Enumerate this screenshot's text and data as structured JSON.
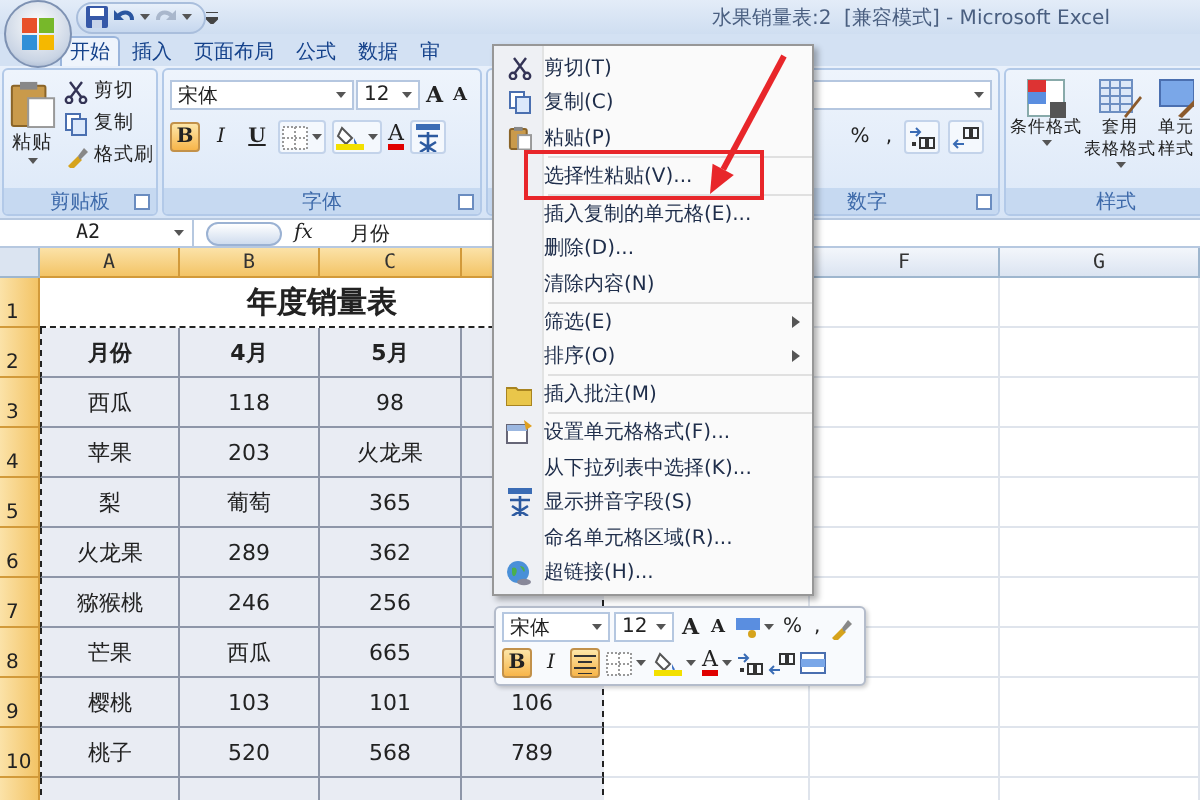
{
  "window": {
    "title": "水果销量表:2  [兼容模式] - Microsoft Excel"
  },
  "tabs": [
    {
      "label": "开始",
      "selected": true
    },
    {
      "label": "插入",
      "selected": false
    },
    {
      "label": "页面布局",
      "selected": false
    },
    {
      "label": "公式",
      "selected": false
    },
    {
      "label": "数据",
      "selected": false
    },
    {
      "label": "审",
      "selected": false
    }
  ],
  "ribbon": {
    "clipboard": {
      "paste": "粘贴",
      "items": [
        "剪切",
        "复制",
        "格式刷"
      ],
      "label": "剪贴板"
    },
    "font": {
      "family": "宋体",
      "size": "12",
      "grow": "A",
      "shrink": "A",
      "color_letter": "A",
      "toggles": [
        {
          "kind": "bold",
          "label": "B",
          "on": true
        },
        {
          "kind": "italic",
          "label": "I",
          "on": false
        },
        {
          "kind": "underline",
          "label": "U",
          "on": false
        }
      ],
      "label": "字体"
    },
    "number": {
      "symbols": [
        "%",
        ","
      ],
      "label": "数字"
    },
    "styles": {
      "buttons": [
        {
          "lines": [
            "条件格式"
          ]
        },
        {
          "lines": [
            "套用",
            "表格格式"
          ]
        },
        {
          "lines": [
            "单元",
            "样式"
          ]
        }
      ],
      "label": "样式"
    }
  },
  "formula_bar": {
    "name_box": "A2",
    "fx": "fx",
    "value": "月份"
  },
  "sheet": {
    "columns": [
      {
        "label": "A",
        "selected": true
      },
      {
        "label": "B",
        "selected": true
      },
      {
        "label": "C",
        "selected": true
      },
      {
        "label": "F",
        "selected": false
      },
      {
        "label": "G",
        "selected": false
      }
    ],
    "rows": [
      {
        "number": "1",
        "selected": true,
        "kind": "title",
        "cells": [
          "年度销量表"
        ]
      },
      {
        "number": "2",
        "selected": true,
        "kind": "heading",
        "cells": [
          "月份",
          "4月",
          "5月"
        ]
      },
      {
        "number": "3",
        "selected": true,
        "kind": "data",
        "cells": [
          "西瓜",
          "118",
          "98"
        ]
      },
      {
        "number": "4",
        "selected": true,
        "kind": "data",
        "cells": [
          "苹果",
          "203",
          "火龙果"
        ]
      },
      {
        "number": "5",
        "selected": true,
        "kind": "data",
        "cells": [
          "梨",
          "葡萄",
          "365"
        ]
      },
      {
        "number": "6",
        "selected": true,
        "kind": "data",
        "cells": [
          "火龙果",
          "289",
          "362"
        ]
      },
      {
        "number": "7",
        "selected": true,
        "kind": "data",
        "cells": [
          "猕猴桃",
          "246",
          "256"
        ]
      },
      {
        "number": "8",
        "selected": true,
        "kind": "data",
        "cells": [
          "芒果",
          "西瓜",
          "665"
        ]
      },
      {
        "number": "9",
        "selected": true,
        "kind": "data",
        "cells": [
          "樱桃",
          "103",
          "101",
          "106"
        ]
      },
      {
        "number": "10",
        "selected": true,
        "kind": "data",
        "cells": [
          "桃子",
          "520",
          "568",
          "789"
        ]
      },
      {
        "selected": true,
        "kind": "data"
      }
    ]
  },
  "context_menu": {
    "groups": [
      [
        {
          "label": "剪切(T)",
          "kind": "item"
        },
        {
          "label": "复制(C)",
          "kind": "item"
        },
        {
          "label": "粘贴(P)",
          "kind": "item"
        }
      ],
      [
        {
          "label": "选择性粘贴(V)...",
          "kind": "item"
        }
      ],
      [
        {
          "label": "插入复制的单元格(E)...",
          "kind": "item"
        },
        {
          "label": "删除(D)...",
          "kind": "item"
        },
        {
          "label": "清除内容(N)",
          "kind": "item"
        }
      ],
      [
        {
          "label": "筛选(E)",
          "kind": "submenu"
        },
        {
          "label": "排序(O)",
          "kind": "submenu"
        }
      ],
      [
        {
          "label": "插入批注(M)",
          "kind": "item"
        }
      ],
      [
        {
          "label": "设置单元格格式(F)...",
          "kind": "item"
        },
        {
          "label": "从下拉列表中选择(K)...",
          "kind": "item"
        },
        {
          "label": "显示拼音字段(S)",
          "kind": "item"
        },
        {
          "label": "命名单元格区域(R)...",
          "kind": "item"
        },
        {
          "label": "超链接(H)...",
          "kind": "item"
        }
      ]
    ]
  },
  "mini_toolbar": {
    "family": "宋体",
    "size": "12",
    "grow": "A",
    "shrink": "A",
    "color_letter": "A",
    "symbols": [
      "%",
      ","
    ],
    "toggles": [
      {
        "kind": "bold",
        "label": "B",
        "on": true
      },
      {
        "kind": "italic",
        "label": "I",
        "on": false
      },
      {
        "kind": "center",
        "on": true
      }
    ]
  }
}
